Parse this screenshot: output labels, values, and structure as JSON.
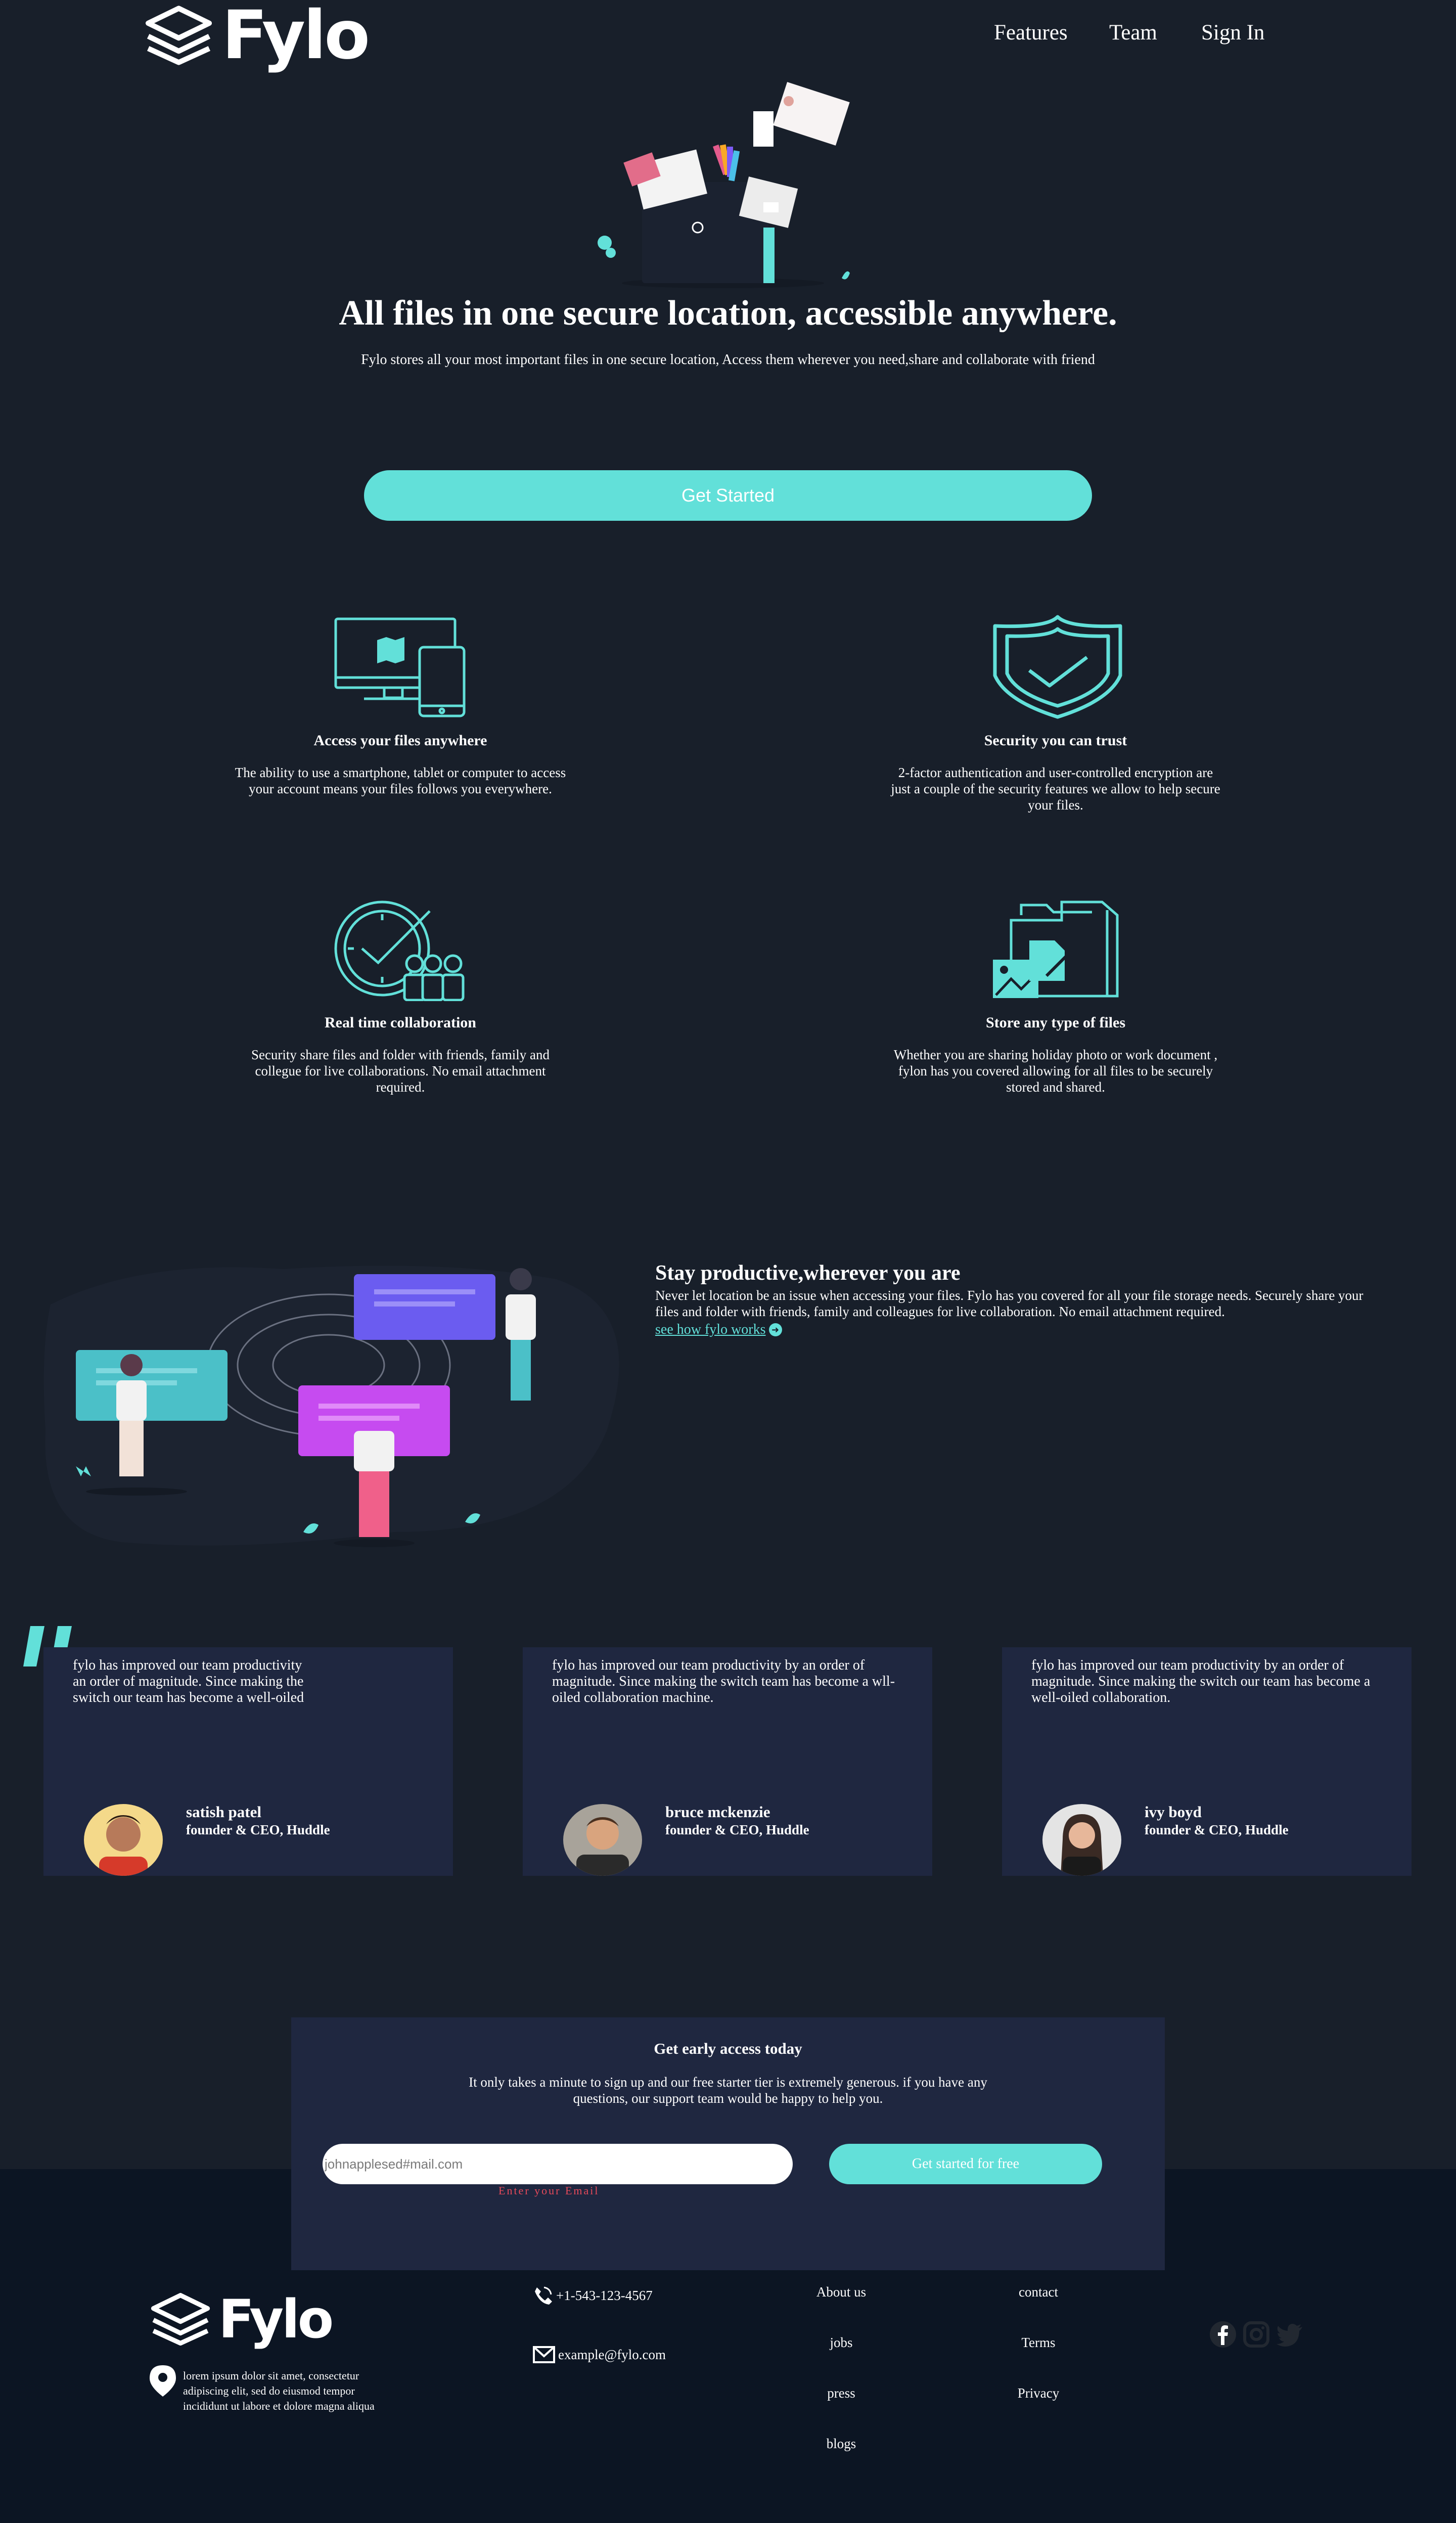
{
  "brand": {
    "name": "Fylo"
  },
  "nav": {
    "items": [
      "Features",
      "Team",
      "Sign In"
    ]
  },
  "hero": {
    "title": "All files in one secure location, accessible anywhere.",
    "subtitle": "Fylo stores all your most important files in one secure location, Access them wherever you need,share and collaborate with friend",
    "cta": "Get Started"
  },
  "features": [
    {
      "icon": "access-devices-icon",
      "title": "Access your files anywhere",
      "text": "The ability to use a smartphone, tablet or computer to access your account means your files follows you everywhere."
    },
    {
      "icon": "security-shield-icon",
      "title": "Security you can trust",
      "text": "2-factor authentication and user-controlled encryption are just a couple of the security features we allow to help secure your files."
    },
    {
      "icon": "collaboration-icon",
      "title": "Real time collaboration",
      "text": "Security share files and folder with friends, family and collegue for live collaborations. No email attachment required."
    },
    {
      "icon": "file-types-icon",
      "title": "Store any type of files",
      "text": "Whether you are sharing holiday photo or work document , fylon has you covered allowing for all files to be securely stored and shared."
    }
  ],
  "productive": {
    "title": "Stay productive,wherever you are",
    "text": "Never let location be an issue when accessing your files. Fylo has you covered for all your file storage needs. Securely share your files and folder with friends, family and colleagues for live collaboration. No email attachment required.",
    "link": "see how fylo works",
    "link_icon": "arrow-right-icon"
  },
  "testimonials": [
    {
      "quote": "fylo has improved our team productivity an order of magnitude. Since making the switch our team has become a well-oiled",
      "name": "satish patel",
      "role": "founder & CEO, Huddle"
    },
    {
      "quote": "fylo has improved our team productivity by an order of magnitude. Since making the switch team has become a wll-oiled collaboration machine.",
      "name": "bruce mckenzie",
      "role": "founder & CEO, Huddle"
    },
    {
      "quote": "fylo has improved our team productivity by an order of magnitude. Since making the switch our team has become a well-oiled collaboration.",
      "name": "ivy boyd",
      "role": "founder & CEO, Huddle"
    }
  ],
  "early_access": {
    "title": "Get early access today",
    "text": "It only takes a minute to sign up and our free starter tier is extremely generous. if you have any questions, our support team would be happy to help you.",
    "email_value": "johnapplesed#mail.com",
    "error": "Enter your Email",
    "button": "Get started for free"
  },
  "footer": {
    "address": "lorem ipsum dolor sit amet, consectetur adipiscing elit, sed do eiusmod tempor incididunt ut labore et dolore magna aliqua",
    "phone": "+1-543-123-4567",
    "email": "example@fylo.com",
    "links_col1": [
      "About us",
      "jobs",
      "press",
      "blogs"
    ],
    "links_col2": [
      "contact",
      "Terms",
      "Privacy"
    ],
    "social": [
      "facebook-icon",
      "instagram-icon",
      "twitter-icon"
    ]
  },
  "colors": {
    "background": "#181f2a",
    "footer": "#0c1523",
    "card": "#1f2740",
    "accent": "#62e0d9",
    "error": "#e84a5a"
  }
}
